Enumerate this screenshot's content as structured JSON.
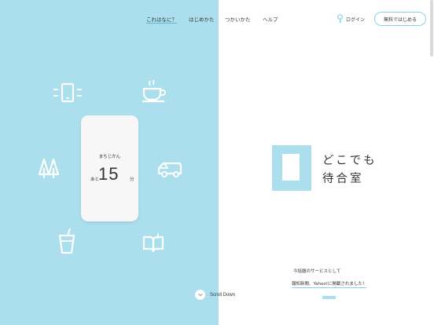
{
  "nav": {
    "items": [
      {
        "label": "これはなに？",
        "active": true
      },
      {
        "label": "はじめかた",
        "active": false
      },
      {
        "label": "つかいかた",
        "active": false
      },
      {
        "label": "ヘルプ",
        "active": false
      }
    ],
    "login_label": "ログイン",
    "start_label": "無料ではじめる"
  },
  "phone": {
    "title": "まちじかん",
    "wait_prefix": "あと",
    "wait_minutes": "15",
    "wait_suffix": "分"
  },
  "icons": [
    "smartphone-icon",
    "coffee-cup-icon",
    "trees-icon",
    "car-icon",
    "drink-cup-icon",
    "open-book-icon"
  ],
  "scroll": {
    "label": "Scroll Down"
  },
  "logo": {
    "line1": "どこでも",
    "line2": "待合室"
  },
  "news": {
    "line1": "今話題のサービスとして",
    "line2": "報知新聞、Yahoo!に掲載されました！"
  },
  "colors": {
    "accent": "#abdfee",
    "border": "#8cd0e4",
    "icon": "#ffffff"
  }
}
